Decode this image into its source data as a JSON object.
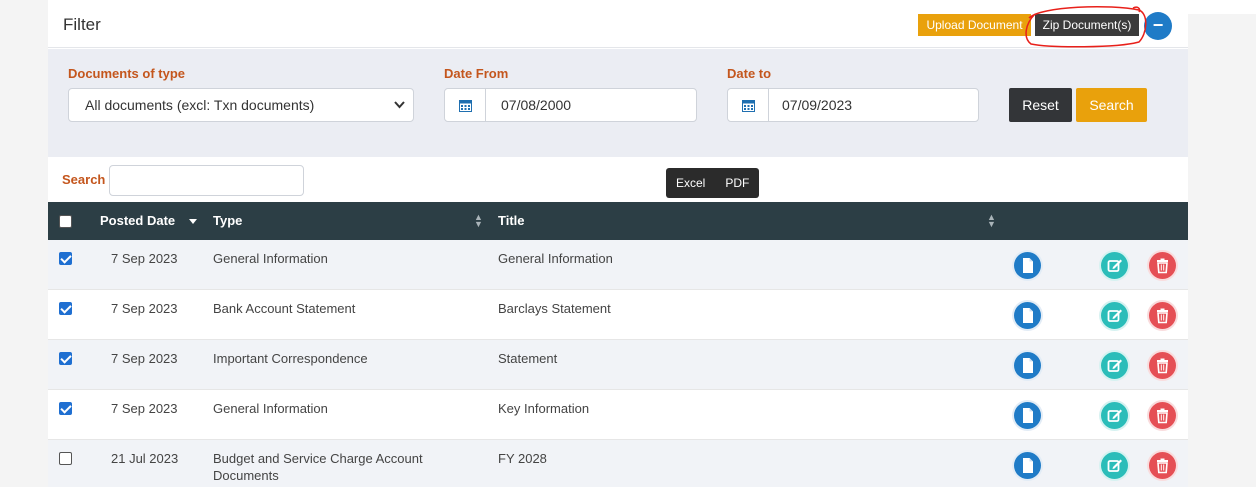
{
  "filter": {
    "title": "Filter",
    "upload_label": "Upload Document",
    "zip_label": "Zip Document(s)",
    "collapse_symbol": "−",
    "documents_of_type_label": "Documents of type",
    "documents_of_type_value": "All documents (excl: Txn documents)",
    "date_from_label": "Date From",
    "date_from_value": "07/08/2000",
    "date_to_label": "Date to",
    "date_to_value": "07/09/2023",
    "reset_label": "Reset",
    "search_label": "Search"
  },
  "table_tools": {
    "search_label": "Search",
    "search_value": "",
    "export_excel": "Excel",
    "export_pdf": "PDF"
  },
  "table": {
    "columns": [
      "Posted Date",
      "Type",
      "Title"
    ],
    "rows": [
      {
        "checked": true,
        "date": "7 Sep 2023",
        "type": "General Information",
        "title": "General Information"
      },
      {
        "checked": true,
        "date": "7 Sep 2023",
        "type": "Bank Account Statement",
        "title": "Barclays Statement"
      },
      {
        "checked": true,
        "date": "7 Sep 2023",
        "type": "Important Correspondence",
        "title": "Statement"
      },
      {
        "checked": true,
        "date": "7 Sep 2023",
        "type": "General Information",
        "title": "Key Information"
      },
      {
        "checked": false,
        "date": "21 Jul 2023",
        "type": "Budget and Service Charge Account Documents",
        "title": "FY 2028"
      }
    ],
    "row_icons": [
      "document-icon",
      "edit-icon",
      "trash-icon"
    ]
  },
  "colors": {
    "accent_orange": "#e9a10c",
    "label_orange": "#c4561d",
    "header_dark": "#2c3e45",
    "primary_blue": "#1f7bc7",
    "teal": "#2bbdb9",
    "danger_red": "#e54f55",
    "annotation_red": "#e8201a"
  }
}
